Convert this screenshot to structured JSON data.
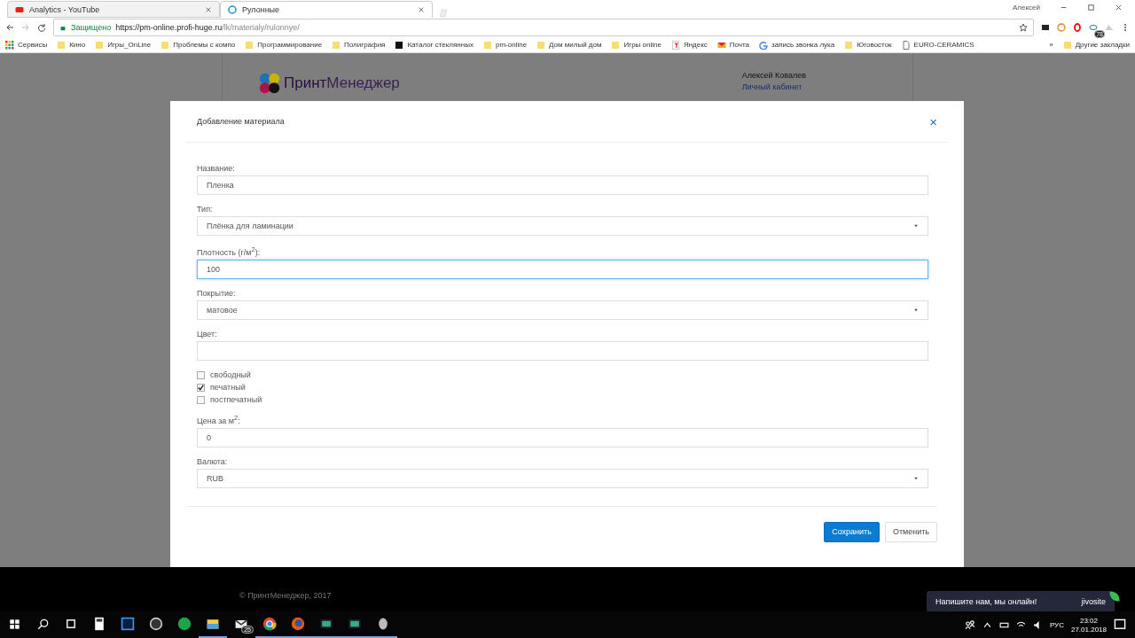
{
  "browser": {
    "tabs": [
      {
        "title": "Analytics - YouTube",
        "kind": "video",
        "selected": false
      },
      {
        "title": "Рулонные",
        "kind": "site",
        "selected": true
      }
    ],
    "profile": "Алексей",
    "secure_label": "Защищено",
    "url_host": "https://pm-online.profi-huge.ru",
    "url_path": "/lk/materialy/rulonnye/",
    "extension_badge": "78",
    "bookmarks": [
      {
        "label": "Сервисы",
        "kind": "apps"
      },
      {
        "label": "Кино",
        "kind": "folder"
      },
      {
        "label": "Игры_OnLine",
        "kind": "folder"
      },
      {
        "label": "Проблемы с компо",
        "kind": "folder"
      },
      {
        "label": "Программирование",
        "kind": "folder"
      },
      {
        "label": "Полиграфия",
        "kind": "folder"
      },
      {
        "label": "Каталог стеклянных",
        "kind": "dark"
      },
      {
        "label": "pm-online",
        "kind": "folder"
      },
      {
        "label": "Дом милый дом",
        "kind": "folder"
      },
      {
        "label": "Игры online",
        "kind": "folder"
      },
      {
        "label": "Яндекс",
        "kind": "yandex"
      },
      {
        "label": "Почта",
        "kind": "mail"
      },
      {
        "label": "запись звонка лука",
        "kind": "google"
      },
      {
        "label": "Юговосток",
        "kind": "folder"
      },
      {
        "label": "EURO-CERAMICS",
        "kind": "page"
      }
    ],
    "more": "»",
    "other_bookmarks": "Другие закладки"
  },
  "site": {
    "logo_a": "Принт",
    "logo_b": "Менеджер",
    "user_name": "Алексей Ковалев",
    "account_link": "Личный кабинет",
    "footer": "© ПринтМенеджер, 2017"
  },
  "modal": {
    "title": "Добавление материала",
    "close": "×",
    "fields": [
      {
        "label": "Название:",
        "kind": "text",
        "value": "Пленка",
        "focused": false
      },
      {
        "label": "Тип:",
        "kind": "select",
        "value": "Плёнка для ламинации",
        "focused": false
      },
      {
        "label": "Плотность (г/м$^{2}$):",
        "kind": "text",
        "value": "100",
        "focused": true
      },
      {
        "label": "Покрытие:",
        "kind": "select",
        "value": "матовое",
        "focused": false
      },
      {
        "label": "Цвет:",
        "kind": "text",
        "focused": false
      },
      {
        "kind": "checks",
        "options": [
          {
            "label": "свободный",
            "checked": false
          },
          {
            "label": "печатный",
            "checked": true
          },
          {
            "label": "постпечатный",
            "checked": false
          }
        ]
      },
      {
        "label": "Цена за м$^{2}$:",
        "kind": "text",
        "value": "0",
        "focused": false
      },
      {
        "label": "Валюта:",
        "kind": "select",
        "value": "RUB",
        "focused": false
      }
    ],
    "buttons": [
      {
        "label": "Сохранить",
        "primary": true
      },
      {
        "label": "Отменить",
        "primary": false
      }
    ]
  },
  "chat": {
    "text": "Напишите нам, мы онлайн!",
    "brand": "jivosite"
  },
  "taskbar": {
    "apps": [
      {
        "kind": "calculator",
        "active": false
      },
      {
        "kind": "photoshop",
        "active": false
      },
      {
        "kind": "j-app",
        "active": false
      },
      {
        "kind": "s-app",
        "active": false
      },
      {
        "kind": "folder",
        "active": true
      },
      {
        "kind": "mail",
        "active": false,
        "badge": "25"
      },
      {
        "kind": "chrome",
        "active": true
      },
      {
        "kind": "firefox",
        "active": true
      },
      {
        "kind": "screen",
        "active": true
      },
      {
        "kind": "screen",
        "active": true
      },
      {
        "kind": "speaker",
        "active": true
      }
    ],
    "lang": "РУС",
    "time": "23:02",
    "date": "27.01.2018"
  }
}
